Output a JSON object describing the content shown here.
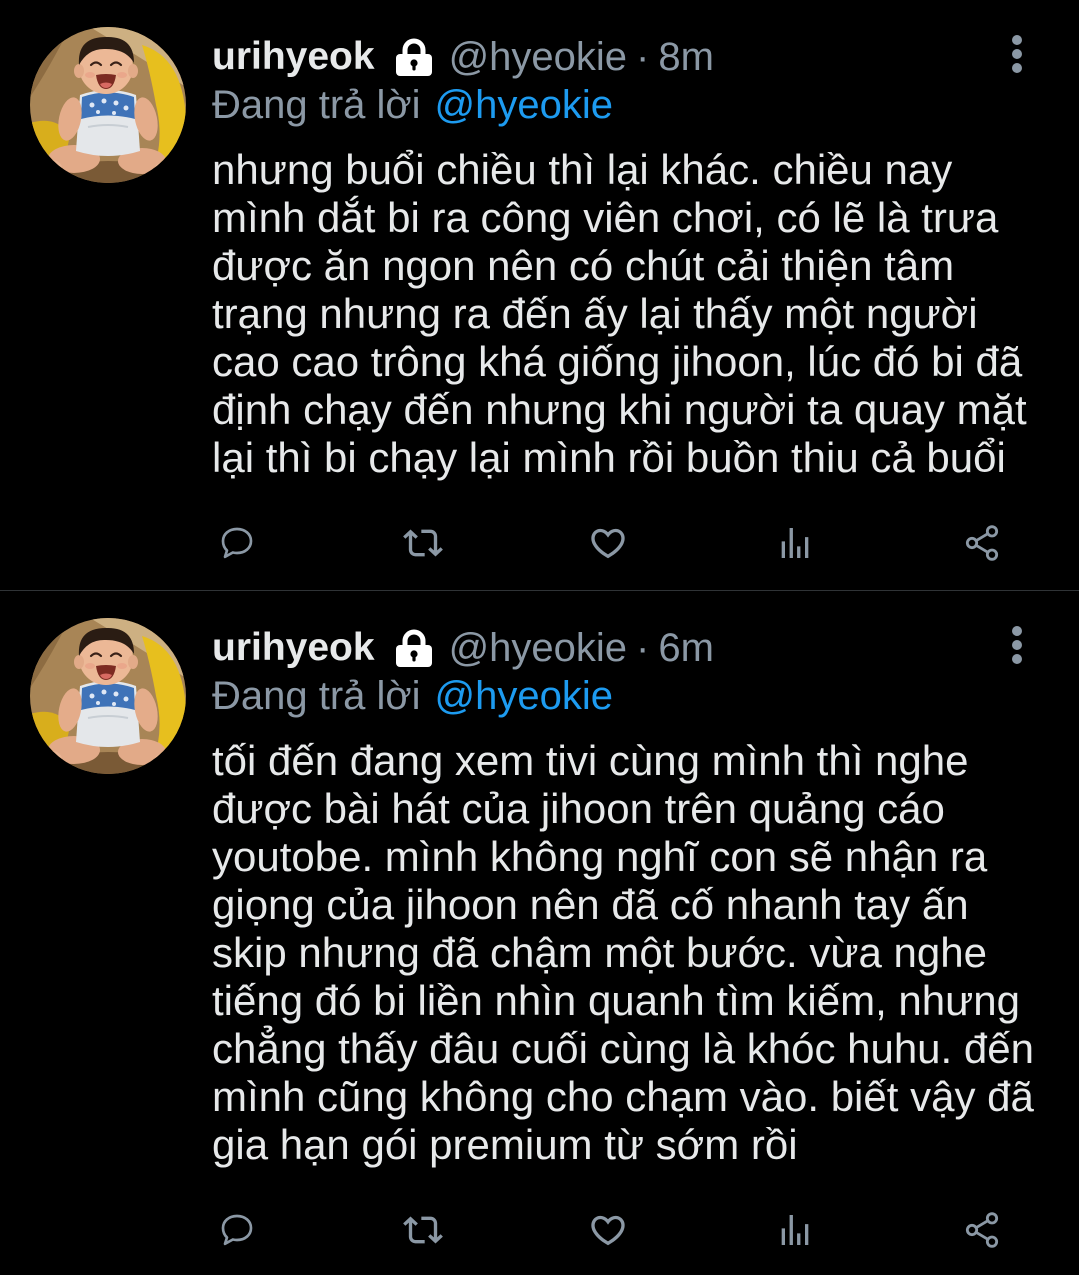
{
  "colors": {
    "background": "#000000",
    "text_primary": "#e7e9ea",
    "text_secondary": "#8b98a5",
    "accent": "#1d9bf0",
    "divider": "#2f3336"
  },
  "tweets": [
    {
      "author": {
        "display_name": "urihyeok",
        "handle": "@hyeokie",
        "protected_icon": "lock-icon"
      },
      "separator": "·",
      "time": "8m",
      "menu_icon": "more-vertical-icon",
      "replying_to": {
        "label": "Đang trả lời",
        "handle": "@hyeokie"
      },
      "body_lines": [
        "nhưng buổi chiều thì lại khác. chiều nay",
        "mình dắt bi ra công viên chơi, có lẽ là trưa",
        "được ăn ngon nên có chút cải thiện tâm",
        "trạng nhưng ra đến ấy lại thấy một người",
        "cao cao trông khá giống jihoon, lúc đó bi đã",
        "định chạy đến nhưng khi người ta quay mặt",
        "lại thì bi chạy lại mình rồi buồn thiu cả buổi"
      ],
      "actions": [
        {
          "name": "reply",
          "icon": "reply-icon"
        },
        {
          "name": "retweet",
          "icon": "retweet-icon"
        },
        {
          "name": "like",
          "icon": "heart-icon"
        },
        {
          "name": "analytics",
          "icon": "analytics-icon"
        },
        {
          "name": "share",
          "icon": "share-icon"
        }
      ]
    },
    {
      "author": {
        "display_name": "urihyeok",
        "handle": "@hyeokie",
        "protected_icon": "lock-icon"
      },
      "separator": "·",
      "time": "6m",
      "menu_icon": "more-vertical-icon",
      "replying_to": {
        "label": "Đang trả lời",
        "handle": "@hyeokie"
      },
      "body_lines": [
        "tối đến đang xem tivi cùng mình thì nghe",
        "được bài hát của jihoon trên quảng cáo",
        "youtobe. mình không nghĩ con sẽ nhận ra",
        "giọng của jihoon nên đã cố nhanh tay ấn",
        "skip nhưng đã chậm một bước. vừa nghe",
        "tiếng đó bi liền nhìn quanh tìm kiếm, nhưng",
        "chẳng thấy đâu cuối cùng là khóc huhu. đến",
        "mình cũng không cho chạm vào. biết vậy đã",
        "gia hạn gói premium từ sớm rồi"
      ],
      "actions": [
        {
          "name": "reply",
          "icon": "reply-icon"
        },
        {
          "name": "retweet",
          "icon": "retweet-icon"
        },
        {
          "name": "like",
          "icon": "heart-icon"
        },
        {
          "name": "analytics",
          "icon": "analytics-icon"
        },
        {
          "name": "share",
          "icon": "share-icon"
        }
      ]
    }
  ]
}
